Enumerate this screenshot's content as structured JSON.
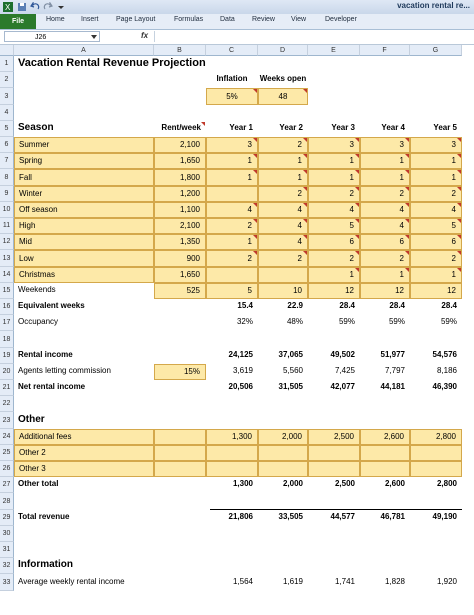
{
  "window": {
    "title": "vacation rental re..."
  },
  "ribbon": {
    "file": "File",
    "tabs": [
      "Home",
      "Insert",
      "Page Layout",
      "Formulas",
      "Data",
      "Review",
      "View",
      "Developer"
    ]
  },
  "formula_bar": {
    "name_box": "J26",
    "fx": "fx"
  },
  "columns": [
    "A",
    "B",
    "C",
    "D",
    "E",
    "F",
    "G"
  ],
  "rows": [
    "1",
    "2",
    "3",
    "4",
    "5",
    "6",
    "7",
    "8",
    "9",
    "10",
    "11",
    "12",
    "13",
    "14",
    "15",
    "16",
    "17",
    "18",
    "19",
    "20",
    "21",
    "22",
    "23",
    "24",
    "25",
    "26",
    "27",
    "28",
    "29",
    "30",
    "31",
    "32",
    "33"
  ],
  "sheet": {
    "title": "Vacation Rental Revenue Projection",
    "inflation_label": "Inflation",
    "weeks_open_label": "Weeks open",
    "inflation": "5%",
    "weeks_open": "48",
    "season_header": "Season",
    "rent_header": "Rent/week",
    "year_headers": [
      "Year 1",
      "Year 2",
      "Year 3",
      "Year 4",
      "Year 5"
    ],
    "seasons": [
      {
        "name": "Summer",
        "rent": "2,100",
        "y": [
          "3",
          "2",
          "3",
          "3",
          "3"
        ]
      },
      {
        "name": "Spring",
        "rent": "1,650",
        "y": [
          "1",
          "1",
          "1",
          "1",
          "1"
        ]
      },
      {
        "name": "Fall",
        "rent": "1,800",
        "y": [
          "1",
          "1",
          "1",
          "1",
          "1"
        ]
      },
      {
        "name": "Winter",
        "rent": "1,200",
        "y": [
          "",
          "2",
          "2",
          "2",
          "2"
        ]
      },
      {
        "name": "Off season",
        "rent": "1,100",
        "y": [
          "4",
          "4",
          "4",
          "4",
          "4"
        ]
      },
      {
        "name": "High",
        "rent": "2,100",
        "y": [
          "2",
          "4",
          "5",
          "4",
          "5"
        ]
      },
      {
        "name": "Mid",
        "rent": "1,350",
        "y": [
          "1",
          "4",
          "6",
          "6",
          "6"
        ]
      },
      {
        "name": "Low",
        "rent": "900",
        "y": [
          "2",
          "2",
          "2",
          "2",
          "2"
        ]
      },
      {
        "name": "Christmas",
        "rent": "1,650",
        "y": [
          "",
          "",
          "1",
          "1",
          "1"
        ]
      },
      {
        "name": "Weekends",
        "rent": "525",
        "y": [
          "5",
          "10",
          "12",
          "12",
          "12"
        ]
      }
    ],
    "equiv_label": "Equivalent weeks",
    "equiv": [
      "15.4",
      "22.9",
      "28.4",
      "28.4",
      "28.4"
    ],
    "occ_label": "Occupancy",
    "occ": [
      "32%",
      "48%",
      "59%",
      "59%",
      "59%"
    ],
    "rental_income_label": "Rental income",
    "rental_income": [
      "24,125",
      "37,065",
      "49,502",
      "51,977",
      "54,576"
    ],
    "agents_label": "Agents letting commission",
    "agents_rate": "15%",
    "agents": [
      "3,619",
      "5,560",
      "7,425",
      "7,797",
      "8,186"
    ],
    "net_label": "Net rental income",
    "net": [
      "20,506",
      "31,505",
      "42,077",
      "44,181",
      "46,390"
    ],
    "other_header": "Other",
    "additional_label": "Additional fees",
    "additional": [
      "1,300",
      "2,000",
      "2,500",
      "2,600",
      "2,800"
    ],
    "other2_label": "Other 2",
    "other3_label": "Other 3",
    "other_total_label": "Other total",
    "other_total": [
      "1,300",
      "2,000",
      "2,500",
      "2,600",
      "2,800"
    ],
    "total_label": "Total revenue",
    "total": [
      "21,806",
      "33,505",
      "44,577",
      "46,781",
      "49,190"
    ],
    "info_header": "Information",
    "avg_label": "Average weekly rental income",
    "avg": [
      "1,564",
      "1,619",
      "1,741",
      "1,828",
      "1,920"
    ]
  }
}
